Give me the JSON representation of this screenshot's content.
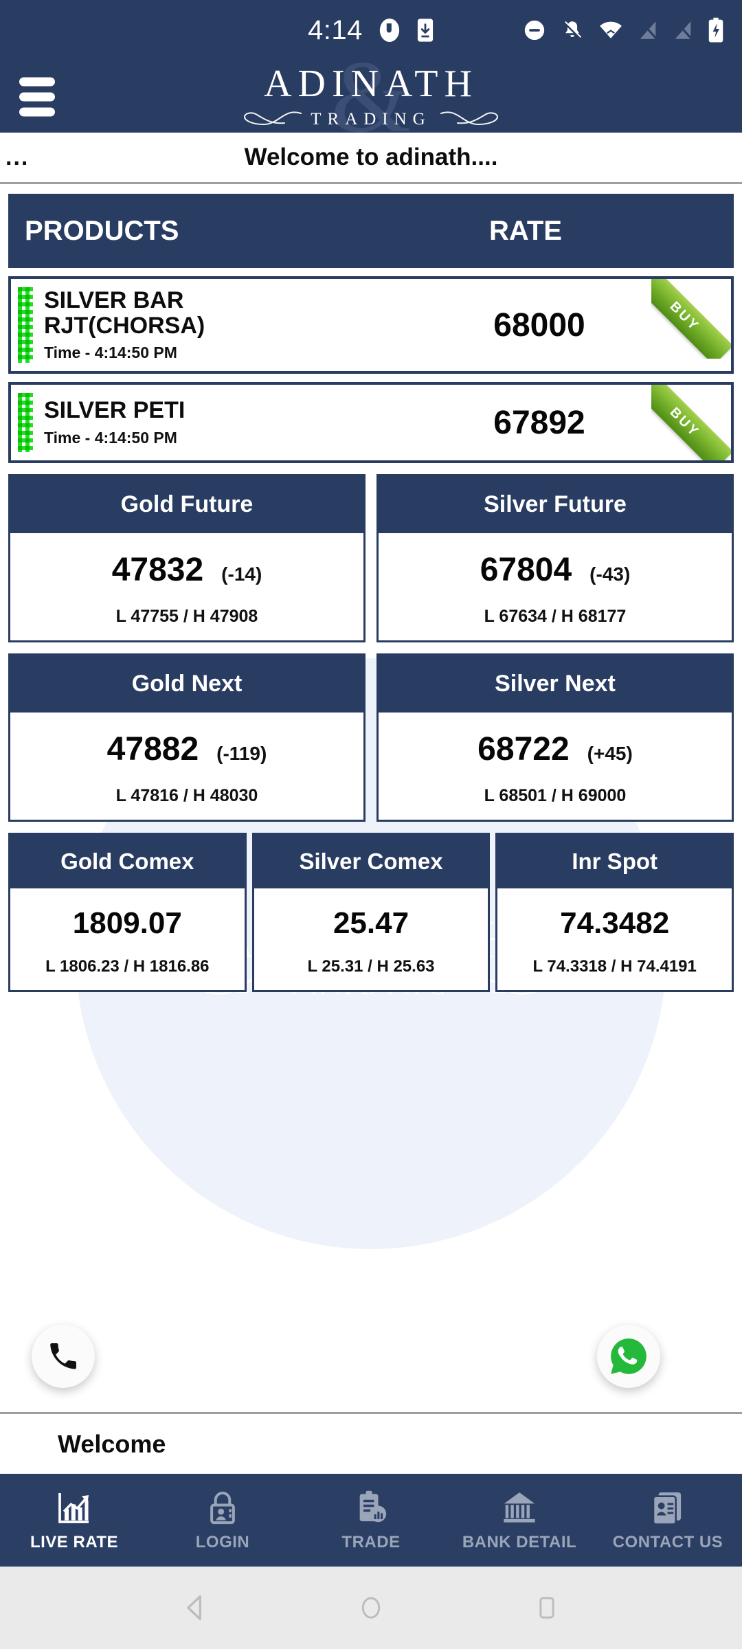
{
  "status_bar": {
    "time": "4:14",
    "left_icons": [
      "screen-record-icon",
      "download-icon"
    ],
    "right_icons": [
      "do-not-disturb-icon",
      "notifications-off-icon",
      "wifi-icon",
      "signal-off-1-icon",
      "signal-off-2-icon",
      "battery-charging-icon"
    ]
  },
  "app_bar": {
    "menu_icon": "hamburger-menu-icon",
    "brand_name": "ADINATH",
    "brand_tagline": "TRADING",
    "brand_monogram": "&"
  },
  "marquee": {
    "prefix": "...",
    "text": "Welcome to adinath...."
  },
  "products_table": {
    "columns": [
      "PRODUCTS",
      "RATE"
    ],
    "rows": [
      {
        "name_line1": "SILVER BAR",
        "name_line2": "RJT(CHORSA)",
        "time": "Time - 4:14:50 PM",
        "rate": "68000",
        "ribbon": "BUY"
      },
      {
        "name_line1": "SILVER PETI",
        "name_line2": "",
        "time": "Time - 4:14:50 PM",
        "rate": "67892",
        "ribbon": "BUY"
      }
    ]
  },
  "rate_cards_row1": [
    {
      "title": "Gold Future",
      "value": "47832",
      "change": "(-14)",
      "low_high": "L 47755 / H 47908"
    },
    {
      "title": "Silver Future",
      "value": "67804",
      "change": "(-43)",
      "low_high": "L 67634 / H 68177"
    }
  ],
  "rate_cards_row2": [
    {
      "title": "Gold Next",
      "value": "47882",
      "change": "(-119)",
      "low_high": "L 47816 / H 48030"
    },
    {
      "title": "Silver Next",
      "value": "68722",
      "change": "(+45)",
      "low_high": "L 68501 / H 69000"
    }
  ],
  "rate_cards_row3": [
    {
      "title": "Gold Comex",
      "value": "1809.07",
      "low_high": "L 1806.23 / H 1816.86"
    },
    {
      "title": "Silver Comex",
      "value": "25.47",
      "low_high": "L 25.31 / H 25.63"
    },
    {
      "title": "Inr Spot",
      "value": "74.3482",
      "low_high": "L 74.3318 / H 74.4191"
    }
  ],
  "watermark": {
    "main": "ADINATH",
    "sub": "TRADING"
  },
  "floating_actions": [
    {
      "name": "call-button",
      "icon": "phone-icon"
    },
    {
      "name": "whatsapp-button",
      "icon": "whatsapp-icon"
    }
  ],
  "footer": {
    "welcome_label": "Welcome"
  },
  "bottom_nav": {
    "items": [
      {
        "label": "LIVE RATE",
        "icon": "bar-chart-icon",
        "active": true
      },
      {
        "label": "LOGIN",
        "icon": "lock-user-icon",
        "active": false
      },
      {
        "label": "TRADE",
        "icon": "clipboard-chart-icon",
        "active": false
      },
      {
        "label": "BANK DETAIL",
        "icon": "bank-icon",
        "active": false
      },
      {
        "label": "CONTACT US",
        "icon": "contact-card-icon",
        "active": false
      }
    ]
  },
  "system_nav": {
    "back": "back-triangle-icon",
    "home": "home-circle-icon",
    "recents": "recents-square-icon"
  },
  "colors": {
    "navy": "#293c61",
    "nav_bar": "#2b3e63",
    "ribbon_green": "#79b52e",
    "dot_green": "#22dd22",
    "whatsapp_green": "#25b93c",
    "watermark_blue": "#eef2fa",
    "inactive_nav": "#9aa5b9"
  }
}
